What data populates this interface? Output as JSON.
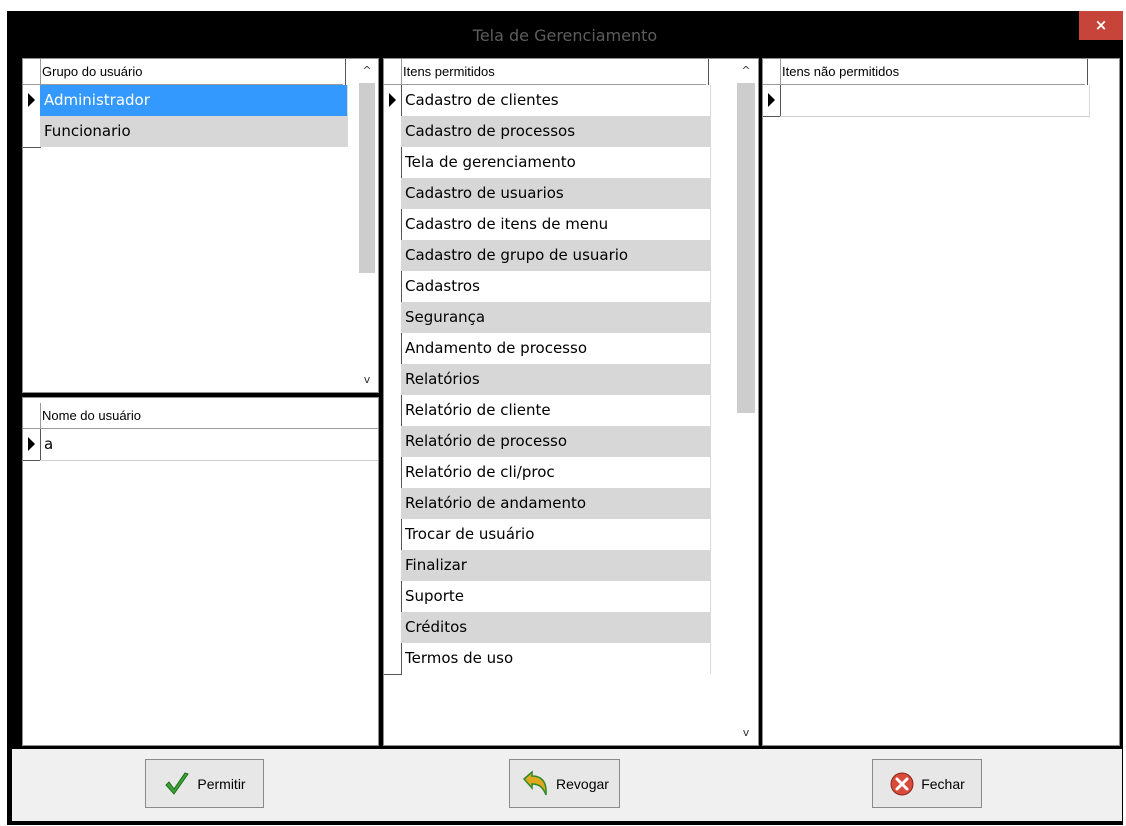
{
  "window": {
    "title": "Tela de Gerenciamento",
    "close_glyph": "×"
  },
  "grupo": {
    "header": "Grupo do usuário",
    "rows": [
      "Administrador",
      "Funcionario"
    ]
  },
  "nome": {
    "header": "Nome do usuário",
    "rows": [
      "a"
    ]
  },
  "permitidos": {
    "header": "Itens permitidos",
    "rows": [
      "Cadastro de clientes",
      "Cadastro de processos",
      "Tela de gerenciamento",
      "Cadastro de usuarios",
      "Cadastro de itens de menu",
      "Cadastro de grupo de usuario",
      "Cadastros",
      "Segurança",
      "Andamento de processo",
      "Relatórios",
      "Relatório de cliente",
      "Relatório de processo",
      "Relatório de cli/proc",
      "Relatório de andamento",
      "Trocar de usuário",
      "Finalizar",
      "Suporte",
      "Créditos",
      "Termos de uso"
    ]
  },
  "nao_permitidos": {
    "header": "Itens não permitidos",
    "rows": [
      ""
    ]
  },
  "buttons": {
    "permitir": "Permitir",
    "revogar": "Revogar",
    "fechar": "Fechar"
  },
  "colors": {
    "selection": "#3399ff",
    "alt_row": "#d7d7d7",
    "close": "#c7443a"
  }
}
